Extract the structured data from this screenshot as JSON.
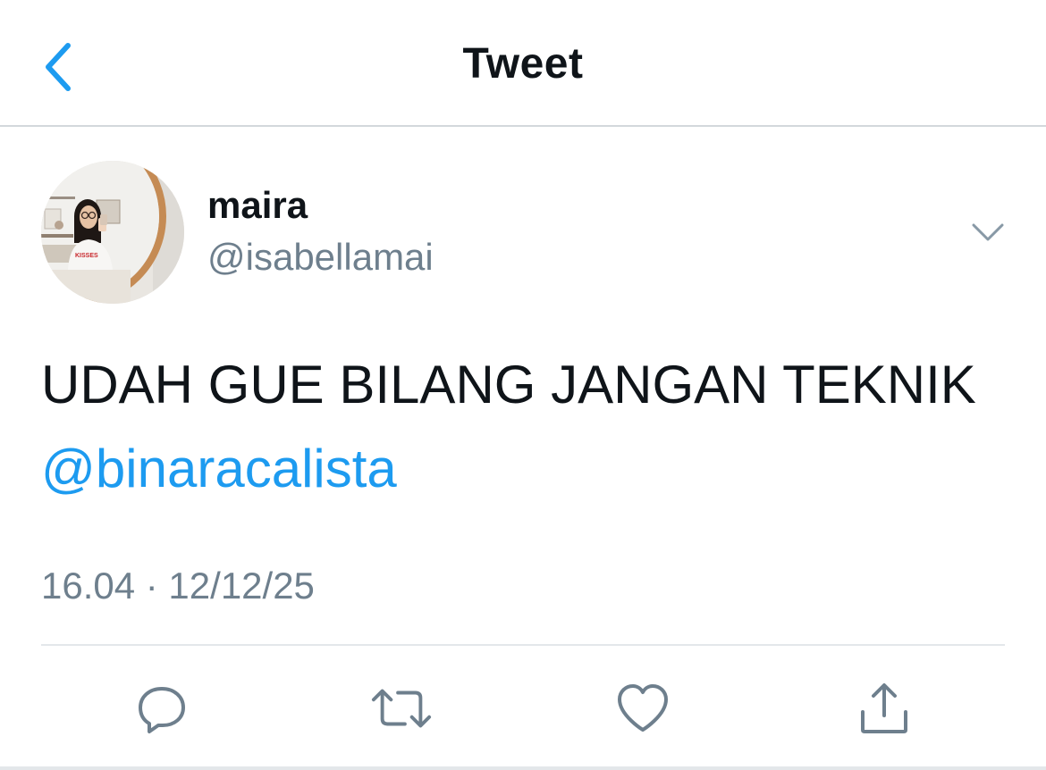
{
  "header": {
    "title": "Tweet",
    "back_icon": "chevron-left-icon"
  },
  "author": {
    "display_name": "maira",
    "handle": "@isabellamai",
    "avatar_shirt_text": "KISSES",
    "more_icon": "chevron-down-icon"
  },
  "tweet": {
    "text": "UDAH GUE BILANG JANGAN TEKNIK",
    "mention": "@binaracalista",
    "timestamp": "16.04 · 12/12/25"
  },
  "actions": [
    {
      "name": "reply",
      "icon": "reply-icon"
    },
    {
      "name": "retweet",
      "icon": "retweet-icon"
    },
    {
      "name": "like",
      "icon": "heart-icon"
    },
    {
      "name": "share",
      "icon": "share-icon"
    }
  ],
  "colors": {
    "accent": "#1d9bf0",
    "text_primary": "#0f1419",
    "text_secondary": "#6e7f8d",
    "icon": "#6e7f8d",
    "divider": "#e3e7ea"
  }
}
